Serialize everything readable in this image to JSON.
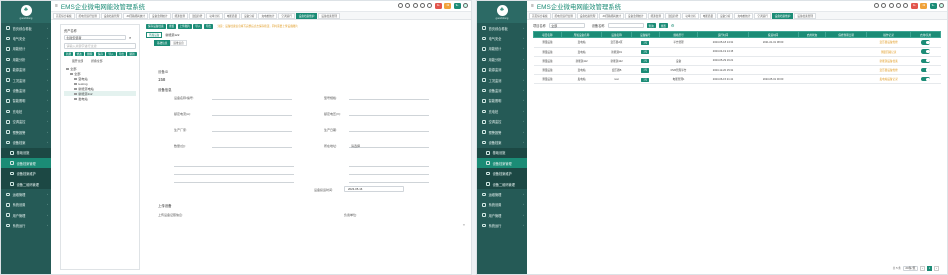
{
  "app_title": "EMS企业微电网能效管理系统",
  "org": "guoshitong",
  "badges": [
    {
      "t": "9+",
      "c": "#e2554d"
    },
    {
      "t": "19",
      "c": "#f0a23a"
    },
    {
      "t": "9+",
      "c": "#1b8c76"
    }
  ],
  "menu": [
    {
      "label": "首页综合看板",
      "act": false
    },
    {
      "label": "电气安全",
      "act": false
    },
    {
      "label": "用能统计",
      "act": false
    },
    {
      "label": "用能分析",
      "act": false
    },
    {
      "label": "能源监测",
      "act": false
    },
    {
      "label": "工况监测",
      "act": false
    },
    {
      "label": "设备监测",
      "act": false
    },
    {
      "label": "智能照明",
      "act": false
    },
    {
      "label": "充电桩",
      "act": false
    },
    {
      "label": "空调监控",
      "act": false
    },
    {
      "label": "预警报警",
      "act": false
    },
    {
      "label": "设备档案",
      "act": false
    },
    {
      "label": "基础设施",
      "act": false,
      "sub": true
    },
    {
      "label": "设备档案管理",
      "act": true,
      "sub": true
    },
    {
      "label": "设备档案维护",
      "act": false,
      "sub": true
    },
    {
      "label": "设备二维码管理",
      "act": false,
      "sub": true
    },
    {
      "label": "运维管理",
      "act": false
    },
    {
      "label": "系统设置",
      "act": false
    },
    {
      "label": "用户管理",
      "act": false
    },
    {
      "label": "系统运行",
      "act": false
    }
  ],
  "tabs": [
    "首页综合看板",
    "配电室运行监测",
    "设备档案管理",
    "JD回路能耗统计",
    "设备监测统计",
    "能源监测",
    "温度趋势",
    "功率分析",
    "电能质量",
    "设备分析",
    "充电桩统计",
    "空调运行",
    "设备档案维护",
    "设备档案管理"
  ],
  "tree": {
    "label": "资产名称",
    "search": "创建安装者",
    "filter_placeholder": "请输入关键字进行过滤",
    "buttons": [
      "新增",
      "修改",
      "删除",
      "保存",
      "导入",
      "导出",
      "刷新"
    ],
    "sub_links": [
      "展开全部",
      "折叠全部"
    ],
    "nodes": [
      {
        "t": "全部",
        "d": 0
      },
      {
        "t": "全部",
        "d": 1
      },
      {
        "t": "变电站",
        "d": 2
      },
      {
        "t": "testing",
        "d": 2
      },
      {
        "t": "新能源电站",
        "d": 2
      },
      {
        "t": "新能源112",
        "d": 2
      },
      {
        "t": "发电站",
        "d": 2
      }
    ],
    "selected": "新能源112"
  },
  "detail": {
    "crumb_btns": [
      "保存设备档案",
      "重置",
      "上传图片",
      "导入",
      "导出"
    ],
    "hint": "注意：设备档案信息填写完整后点击保存按钮，同时需要上传设备图片",
    "crumb": [
      "所属设备",
      "新能源122"
    ],
    "subtabs": [
      "基础信息",
      "运维信息"
    ],
    "id_label": "设备ID",
    "id_value": "158",
    "sec1": "设备信息",
    "left_fields": [
      "设备名称/编号:",
      "额定电流(A):",
      "生产厂家:",
      "数量(台):"
    ],
    "right_fields": [
      "型号规格:",
      "额定电压(V):",
      "生产日期:",
      "所在地址:"
    ],
    "right_vals": [
      "",
      "",
      "",
      "请选择"
    ],
    "date_label": "设备投运时间:",
    "date_value": "2023-05-16",
    "sec2": "上传设备",
    "upload_label": "上传设备证照信息:",
    "owner_label": "负责单位:"
  },
  "table_filter": {
    "label": "项目名称",
    "value": "全部",
    "label2": "设备名称",
    "search_btn": "查询",
    "reset_btn": "重置"
  },
  "table": {
    "headers": [
      "项目名称",
      "所属设备名称",
      "设备名称",
      "设备编号",
      "规格型号",
      "运行时间",
      "投运时间",
      "启用状态",
      "保修到期日期",
      "操作记录",
      "启用/禁用"
    ],
    "rows": [
      [
        "测量设备",
        "变电站",
        "变压器A区",
        "1号",
        "平台管理",
        "2023-05-18 14:31",
        "2021-01-01 08:00",
        "",
        "",
        "变压器设备维修",
        "on"
      ],
      [
        "测量设备",
        "变电站",
        "新能源01",
        "1号",
        "",
        "2023-04-19 14:15",
        "",
        "",
        "",
        "测量回路记录",
        "on"
      ],
      [
        "测量设备",
        "新能源112",
        "新能源122",
        "1号",
        "设备",
        "2023-05-29 16:21",
        "",
        "",
        "",
        "新能源设备档案",
        "on"
      ],
      [
        "测量设备",
        "变电站",
        "变压器B",
        "1号",
        "DVR管理平台",
        "2023-12-20 15:31",
        "",
        "",
        "",
        "变压器设备维修",
        "on"
      ],
      [
        "测量设备",
        "发电站",
        "test",
        "1号",
        "电能管理1",
        "2023-06-15 21:41",
        "2023-05-01 00:00",
        "",
        "",
        "发电站设备记录",
        "on"
      ]
    ],
    "pager": {
      "total": "共 5 条",
      "size": "20条/页",
      "page": "1"
    }
  }
}
